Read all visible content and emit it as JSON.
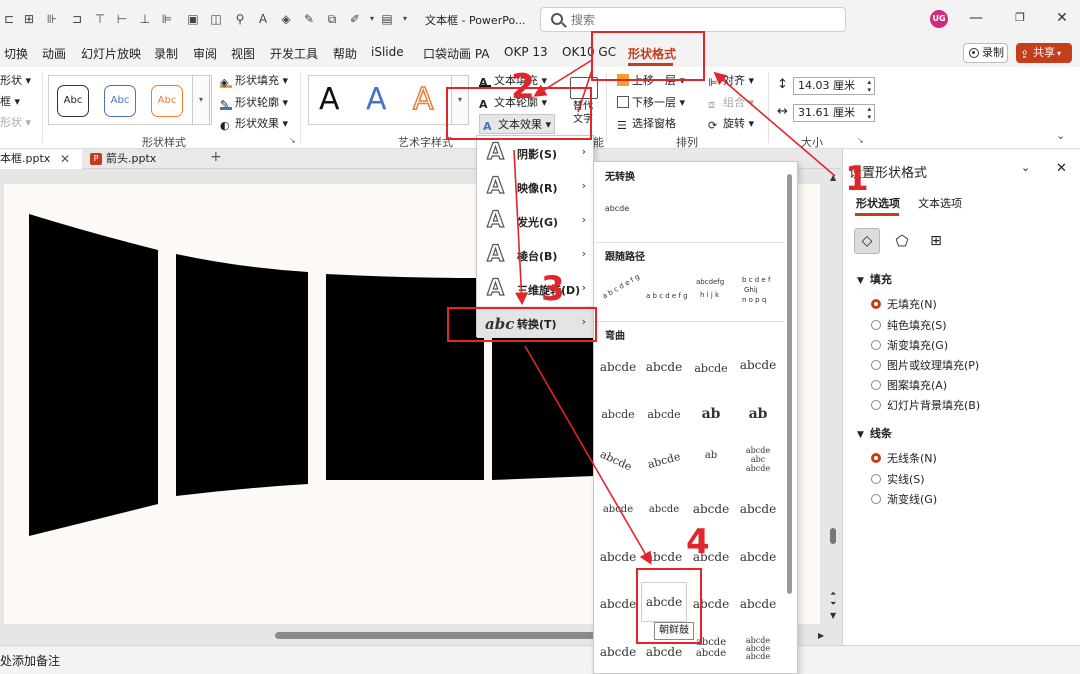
{
  "titlebar": {
    "doc_title": "文本框 - PowerPo...",
    "search_placeholder": "搜索",
    "avatar": "UG"
  },
  "tabs": [
    {
      "label": "切换"
    },
    {
      "label": "动画"
    },
    {
      "label": "幻灯片放映"
    },
    {
      "label": "录制"
    },
    {
      "label": "审阅"
    },
    {
      "label": "视图"
    },
    {
      "label": "开发工具"
    },
    {
      "label": "帮助"
    },
    {
      "label": "iSlide"
    },
    {
      "label": "口袋动画 PA"
    },
    {
      "label": "OKP 13"
    },
    {
      "label": "OK10 GC"
    },
    {
      "label": "形状格式"
    }
  ],
  "record_label": "录制",
  "share_label": "共享",
  "ribbon": {
    "left_cut": [
      "形状",
      "框",
      "形状"
    ],
    "shape_style_sample": "Abc",
    "shape_fill": "形状填充",
    "shape_outline": "形状轮廓",
    "shape_effects": "形状效果",
    "group_shape_styles": "形状样式",
    "wordart_letter": "A",
    "group_wordart": "艺术字样式",
    "text_fill": "文本填充",
    "text_outline": "文本轮廓",
    "text_effects": "文本效果",
    "alt_text": "替代文字",
    "group_accessibility": "能",
    "bring_forward": "上移一层",
    "send_backward": "下移一层",
    "selection_pane": "选择窗格",
    "align": "对齐",
    "group_btn": "组合",
    "rotate": "旋转",
    "group_arrange": "排列",
    "height_value": "14.03 厘米",
    "width_value": "31.61 厘米",
    "group_size": "大小"
  },
  "doc_tabs": [
    {
      "label": "本框.pptx"
    },
    {
      "label": "箭头.pptx"
    }
  ],
  "effects_menu": [
    {
      "label": "阴影(S)"
    },
    {
      "label": "映像(R)"
    },
    {
      "label": "发光(G)"
    },
    {
      "label": "棱台(B)"
    },
    {
      "label": "三维旋转(D)"
    },
    {
      "label": "转换(T)"
    }
  ],
  "transform_menu": {
    "no_transform": "无转换",
    "no_transform_sample": "abcde",
    "follow_path": "跟随路径",
    "warp": "弯曲",
    "sample": "abcde",
    "tooltip": "朝鲜鼓"
  },
  "format_pane": {
    "title": "设置形状格式",
    "tab_shape": "形状选项",
    "tab_text": "文本选项",
    "fill_section": "填充",
    "fill_options": [
      {
        "label": "无填充(N)",
        "selected": true
      },
      {
        "label": "纯色填充(S)",
        "selected": false
      },
      {
        "label": "渐变填充(G)",
        "selected": false
      },
      {
        "label": "图片或纹理填充(P)",
        "selected": false
      },
      {
        "label": "图案填充(A)",
        "selected": false
      },
      {
        "label": "幻灯片背景填充(B)",
        "selected": false
      }
    ],
    "line_section": "线条",
    "line_options": [
      {
        "label": "无线条(N)",
        "selected": true
      },
      {
        "label": "实线(S)",
        "selected": false
      },
      {
        "label": "渐变线(G)",
        "selected": false
      }
    ]
  },
  "notes_placeholder": "处添加备注",
  "annotations": [
    "1",
    "2",
    "3",
    "4"
  ],
  "colors": {
    "accent": "#c43e1c",
    "annotation_red": "#e0262b",
    "slide_shape": "#000000",
    "slide_bg": "#fdf9f4"
  },
  "icons": [
    "search-icon",
    "restore-icon",
    "minimize-icon",
    "close-icon",
    "fill-bucket-icon",
    "pentagon-icon",
    "size-properties-icon",
    "chevron-down-icon",
    "chevron-right-icon"
  ]
}
